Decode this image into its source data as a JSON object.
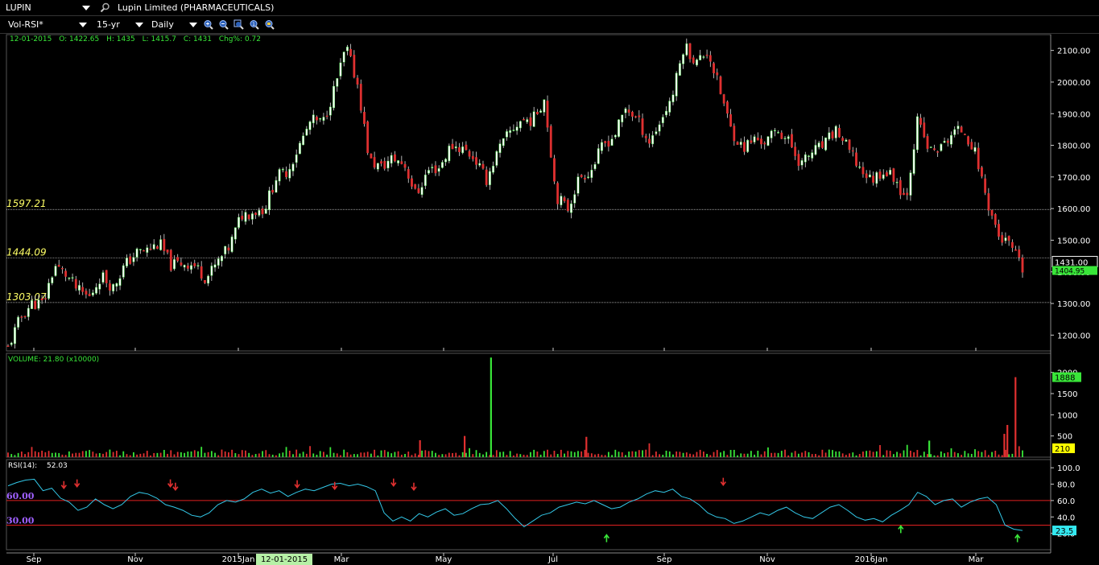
{
  "toolbar": {
    "symbol": "LUPIN",
    "company": "Lupin Limited  (PHARMACEUTICALS)",
    "template": "Vol-RSI*",
    "period": "15-yr",
    "interval": "Daily",
    "icons": [
      "zoom-in-icon",
      "zoom-out-icon",
      "zoom-fit-icon",
      "zoom-reset-icon",
      "zoom-select-icon"
    ]
  },
  "ohlc": {
    "date": "12-01-2015",
    "open": "O: 1422.65",
    "high": "H: 1435",
    "low": "L: 1415.7",
    "close": "C: 1431",
    "change": "Chg%: 0.72"
  },
  "colors": {
    "up": "#39e639",
    "down": "#e03030",
    "rsi_line": "#33c8e8",
    "hline_price": "#cfcfcf",
    "hline_rsi": "#e02020",
    "level_text": "#ffff66",
    "rsi_level_text": "#a060ff"
  },
  "chart_data": [
    {
      "type": "candlestick",
      "title": "",
      "ylim": [
        1150,
        2150
      ],
      "yticks": [
        "1200.00",
        "1300.00",
        "1400.00",
        "1500.00",
        "1600.00",
        "1700.00",
        "1800.00",
        "1900.00",
        "2000.00",
        "2100.00"
      ],
      "xticks": [
        "Sep",
        "Nov",
        "2015Jan",
        "Mar",
        "May",
        "Jul",
        "Sep",
        "Nov",
        "2016Jan",
        "Mar"
      ],
      "cursor_date": "12-01-2015",
      "levels": [
        {
          "label": "1597.21",
          "value": 1597.21
        },
        {
          "label": "1444.09",
          "value": 1444.09
        },
        {
          "label": "1303.07",
          "value": 1303.07
        }
      ],
      "last_close": "1431.00",
      "second_marker": "1404.95",
      "close_path": [
        1160,
        1250,
        1300,
        1300,
        1420,
        1390,
        1340,
        1320,
        1390,
        1350,
        1420,
        1460,
        1470,
        1490,
        1420,
        1430,
        1420,
        1380,
        1430,
        1480,
        1580,
        1590,
        1600,
        1700,
        1720,
        1800,
        1880,
        1870,
        1980,
        2110,
        1990,
        1750,
        1730,
        1760,
        1740,
        1640,
        1720,
        1730,
        1800,
        1790,
        1760,
        1690,
        1780,
        1840,
        1880,
        1880,
        1950,
        1640,
        1600,
        1700,
        1720,
        1800,
        1830,
        1920,
        1880,
        1810,
        1880,
        1960,
        2120,
        2060,
        2100,
        1980,
        1850,
        1790,
        1820,
        1810,
        1850,
        1810,
        1740,
        1780,
        1800,
        1850,
        1790,
        1730,
        1690,
        1720,
        1700,
        1630,
        1880,
        1780,
        1790,
        1840,
        1850,
        1770,
        1620,
        1510,
        1480,
        1404.95
      ]
    },
    {
      "type": "bar",
      "title": "VOLUME: 21.80 (x10000)",
      "ylim": [
        0,
        2450
      ],
      "yticks": [
        "500",
        "1000",
        "1500",
        "2000"
      ],
      "last_value": "1888",
      "avg_value": "210",
      "spikes": [
        {
          "position": 0.476,
          "value": 2350,
          "color": "up"
        },
        {
          "position": 0.993,
          "value": 1888,
          "color": "down"
        },
        {
          "position": 0.985,
          "value": 760,
          "color": "down"
        },
        {
          "position": 0.982,
          "value": 550,
          "color": "down"
        },
        {
          "position": 0.45,
          "value": 500,
          "color": "down"
        },
        {
          "position": 0.57,
          "value": 480,
          "color": "down"
        },
        {
          "position": 0.406,
          "value": 400,
          "color": "down"
        },
        {
          "position": 0.908,
          "value": 390,
          "color": "up"
        }
      ]
    },
    {
      "type": "line",
      "title": "RSI(14):",
      "current": "52.03",
      "last_value": "23.5",
      "ylim": [
        0,
        110
      ],
      "yticks": [
        "20.0",
        "40.0",
        "60.0",
        "80.0",
        "100.0"
      ],
      "levels": [
        {
          "label": "60.00",
          "value": 60
        },
        {
          "label": "30.00",
          "value": 30
        }
      ],
      "rsi_path": [
        78,
        82,
        85,
        86,
        72,
        75,
        63,
        58,
        48,
        52,
        62,
        55,
        50,
        55,
        65,
        70,
        68,
        63,
        55,
        52,
        48,
        42,
        40,
        45,
        55,
        60,
        58,
        62,
        70,
        74,
        69,
        72,
        65,
        70,
        74,
        72,
        76,
        80,
        81,
        78,
        80,
        77,
        72,
        45,
        35,
        40,
        35,
        44,
        40,
        46,
        50,
        42,
        44,
        50,
        55,
        56,
        60,
        50,
        38,
        28,
        35,
        42,
        45,
        52,
        55,
        58,
        56,
        60,
        55,
        50,
        52,
        58,
        62,
        68,
        72,
        70,
        74,
        65,
        62,
        55,
        45,
        40,
        38,
        32,
        35,
        40,
        45,
        42,
        48,
        52,
        45,
        40,
        38,
        45,
        52,
        55,
        48,
        40,
        36,
        38,
        34,
        42,
        48,
        55,
        70,
        65,
        55,
        60,
        62,
        52,
        58,
        62,
        64,
        55,
        30,
        25,
        23.5
      ],
      "arrows": [
        {
          "position": 0.055,
          "value": 72,
          "dir": "down",
          "color": "down"
        },
        {
          "position": 0.068,
          "value": 74,
          "dir": "down",
          "color": "down"
        },
        {
          "position": 0.16,
          "value": 74,
          "dir": "down",
          "color": "down"
        },
        {
          "position": 0.165,
          "value": 70,
          "dir": "down",
          "color": "down"
        },
        {
          "position": 0.285,
          "value": 73,
          "dir": "down",
          "color": "down"
        },
        {
          "position": 0.322,
          "value": 71,
          "dir": "down",
          "color": "down"
        },
        {
          "position": 0.38,
          "value": 75,
          "dir": "down",
          "color": "down"
        },
        {
          "position": 0.4,
          "value": 70,
          "dir": "down",
          "color": "down"
        },
        {
          "position": 0.59,
          "value": 21,
          "dir": "up",
          "color": "up"
        },
        {
          "position": 0.705,
          "value": 76,
          "dir": "down",
          "color": "down"
        },
        {
          "position": 0.88,
          "value": 32,
          "dir": "up",
          "color": "up"
        },
        {
          "position": 0.995,
          "value": 21,
          "dir": "up",
          "color": "up"
        }
      ]
    }
  ]
}
